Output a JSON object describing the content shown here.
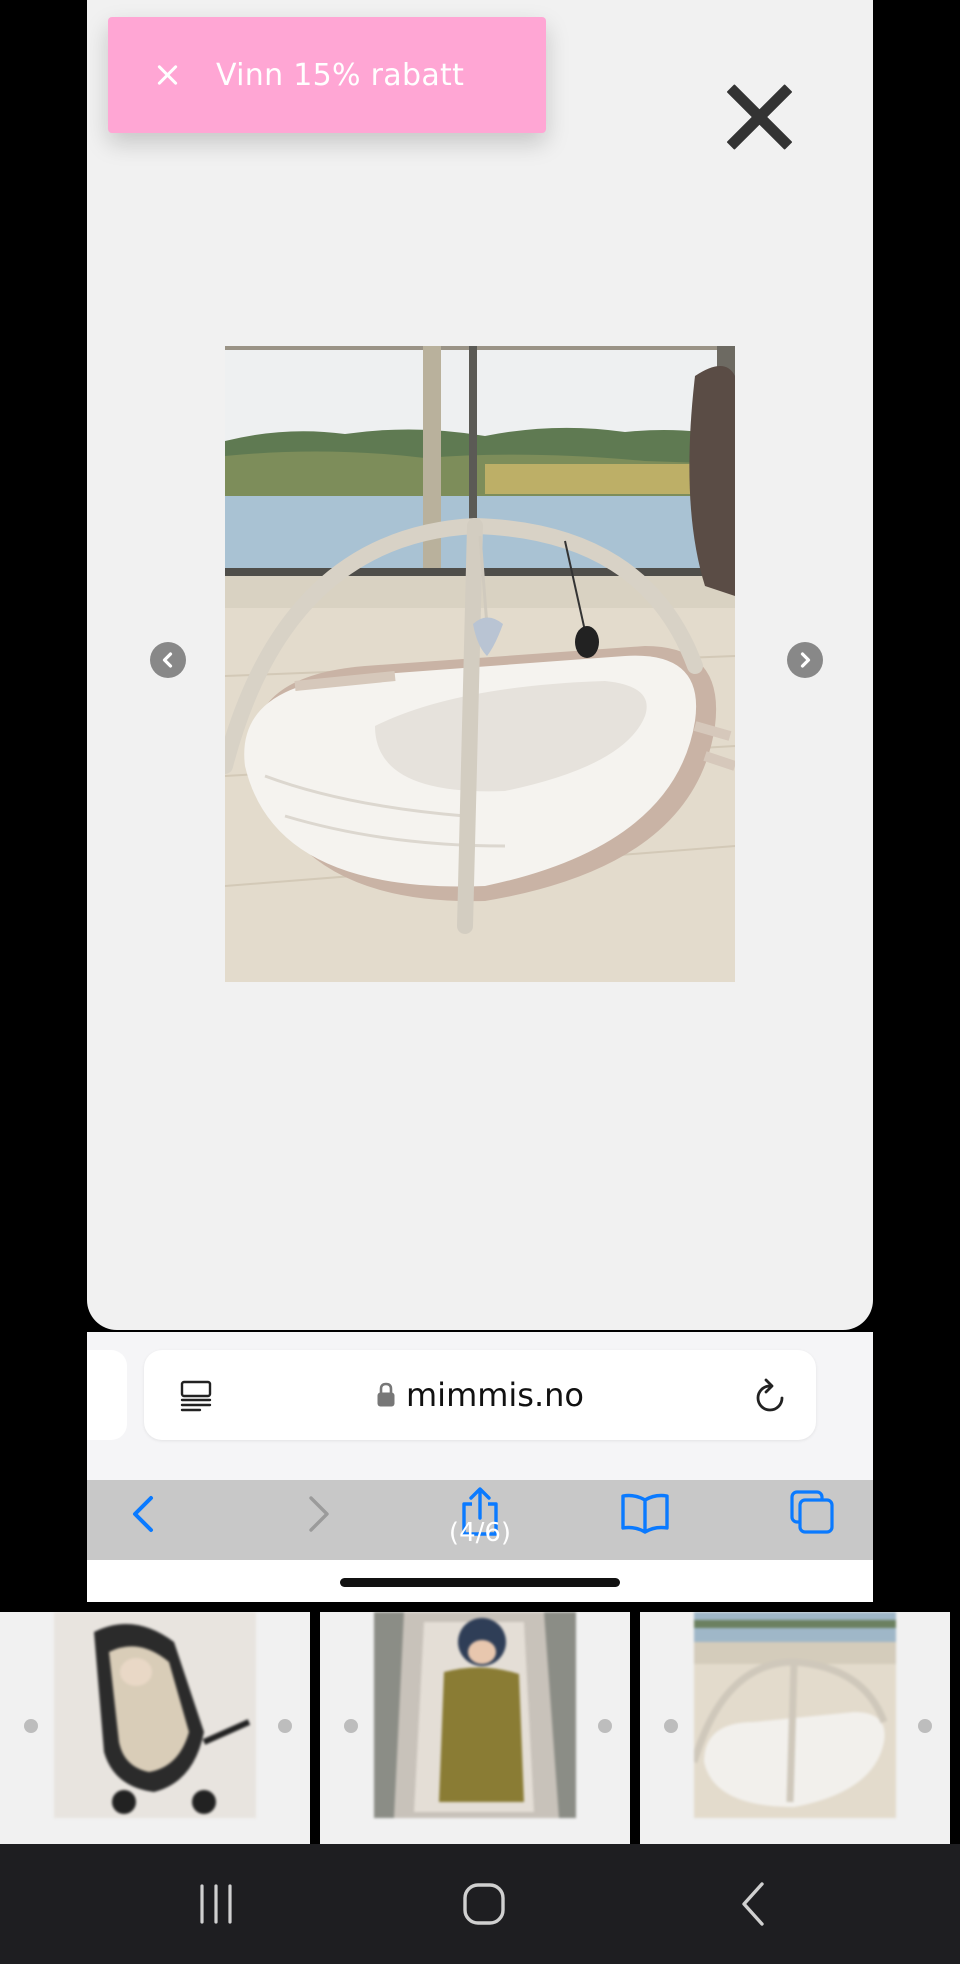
{
  "promo": {
    "text": "Vinn 15% rabatt"
  },
  "lightbox": {
    "close_icon": "close-x-icon",
    "prev_icon": "chevron-left-circle-icon",
    "next_icon": "chevron-right-circle-icon",
    "counter": "(4/6)"
  },
  "browser": {
    "url": "mimmis.no",
    "icons": [
      "reader-icon",
      "lock-icon",
      "reload-icon",
      "back-icon",
      "forward-icon",
      "share-icon",
      "bookmarks-icon",
      "tabs-icon"
    ]
  },
  "android_nav": {
    "icons": [
      "recents-icon",
      "home-icon",
      "back-icon"
    ]
  },
  "colors": {
    "promo_bg": "#ffa6d4",
    "lightbox_bg": "#f1f1f1",
    "safari_blue": "#0a7aff",
    "android_bar": "#1e1e21"
  }
}
